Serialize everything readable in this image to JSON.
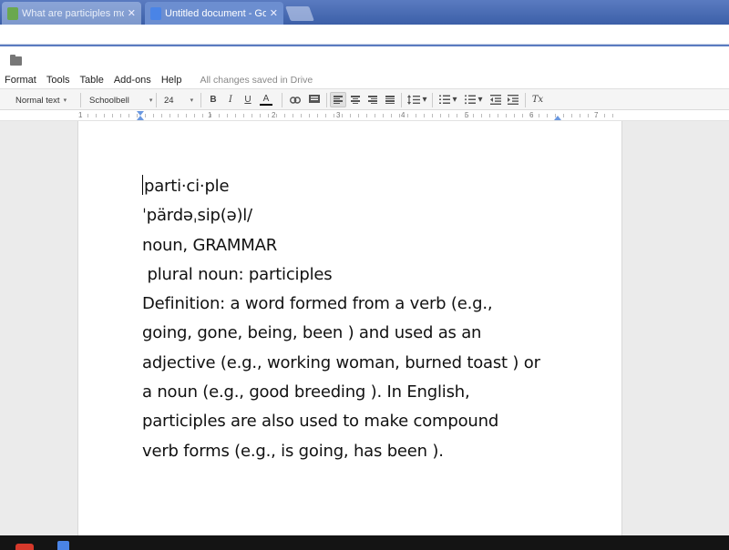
{
  "browser": {
    "tabs": [
      {
        "title": "What are participles mo",
        "active": false,
        "icon": "tree-favicon-icon"
      },
      {
        "title": "Untitled document - Goo",
        "active": true,
        "icon": "docs-favicon-icon"
      }
    ],
    "close_glyph": "✕"
  },
  "menu": {
    "items": [
      "Format",
      "Tools",
      "Table",
      "Add-ons",
      "Help"
    ],
    "save_status": "All changes saved in Drive"
  },
  "toolbar": {
    "style": "Normal text",
    "font": "Schoolbell",
    "size": "24",
    "bold": "B",
    "italic": "I",
    "underline": "U",
    "text_color": "A",
    "clear_format": "Tx",
    "dropdown_glyph": "▾",
    "text_color_value": "#000000"
  },
  "ruler": {
    "labels": [
      "1",
      "1",
      "2",
      "3",
      "4",
      "5",
      "6",
      "7"
    ]
  },
  "document": {
    "lines": [
      "parti·ci·ple",
      "ˈpärdəˌsip(ə)l/",
      "noun, GRAMMAR",
      " plural noun: participles",
      "Definition: a word formed from a verb (e.g.,",
      "going, gone, being, been ) and used as an",
      "adjective (e.g., working woman, burned toast ) or",
      "a noun (e.g., good breeding ). In English,",
      "participles are also used to make compound",
      "verb forms (e.g., is going, has been )."
    ]
  },
  "colors": {
    "tabstrip": "#4a6db3",
    "active_tab": "#6c8ed0",
    "docs_blue": "#4a84e6",
    "taskbar_red": "#d6392b"
  }
}
